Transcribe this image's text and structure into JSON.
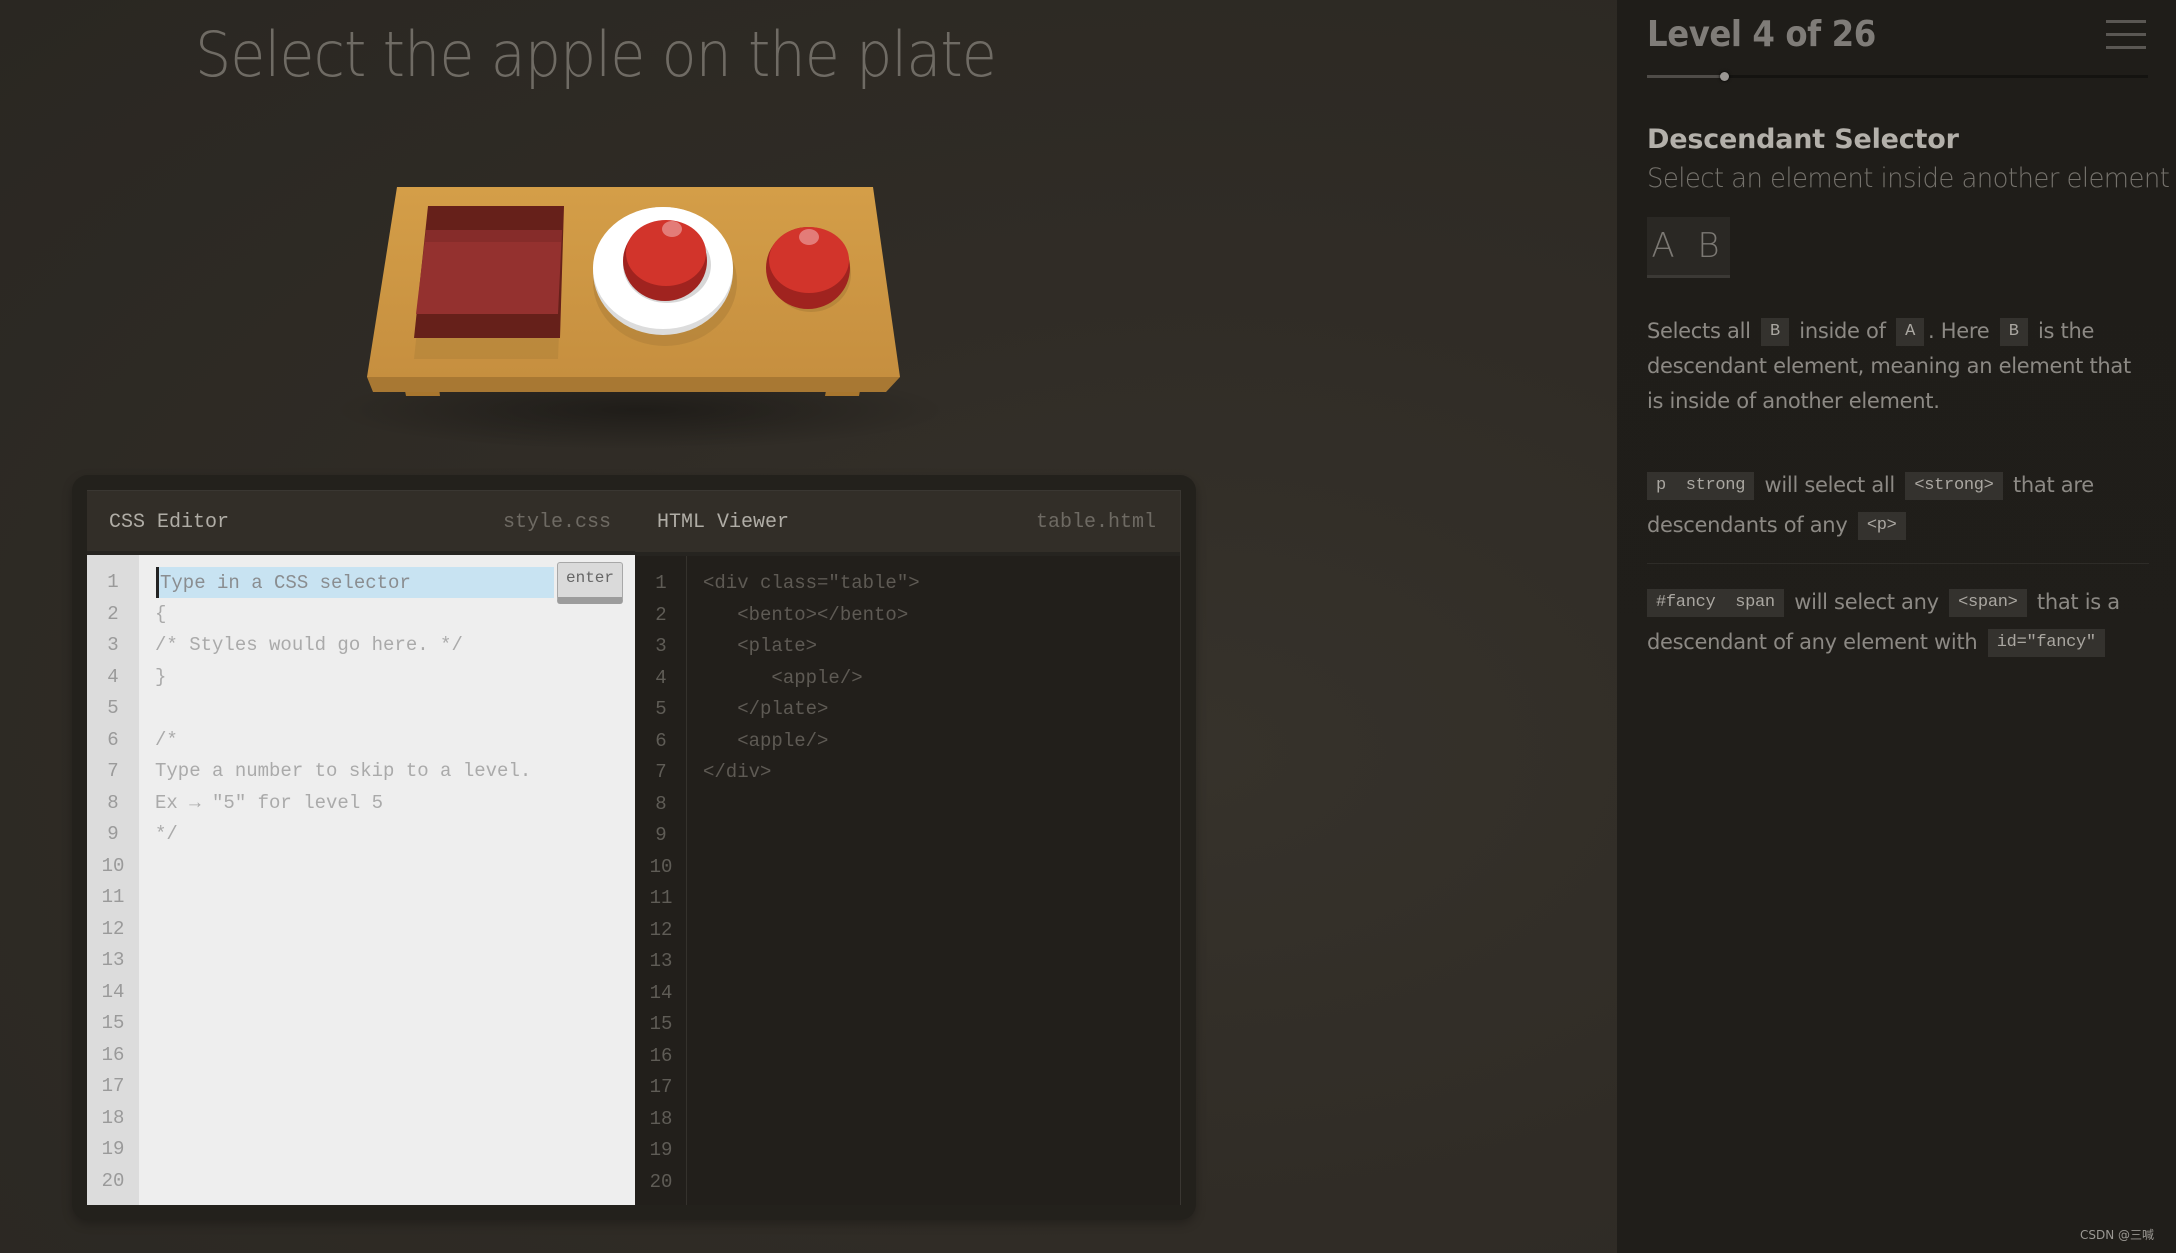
{
  "game": {
    "instruction": "Select the apple on the plate",
    "table_items": [
      "bento",
      "plate with apple",
      "apple"
    ]
  },
  "css_editor": {
    "name": "CSS Editor",
    "file": "style.css",
    "input_placeholder": "Type in a CSS selector",
    "input_value": "",
    "enter_label": "enter",
    "line_numbers": [
      "1",
      "2",
      "3",
      "4",
      "5",
      "6",
      "7",
      "8",
      "9",
      "10",
      "11",
      "12",
      "13",
      "14",
      "15",
      "16",
      "17",
      "18",
      "19",
      "20"
    ],
    "lines": [
      "",
      "{",
      "/* Styles would go here. */",
      "}",
      "",
      "/*",
      "Type a number to skip to a level.",
      "Ex → \"5\" for level 5",
      "*/"
    ]
  },
  "html_viewer": {
    "name": "HTML Viewer",
    "file": "table.html",
    "line_numbers": [
      "1",
      "2",
      "3",
      "4",
      "5",
      "6",
      "7",
      "8",
      "9",
      "10",
      "11",
      "12",
      "13",
      "14",
      "15",
      "16",
      "17",
      "18",
      "19",
      "20"
    ],
    "lines": [
      "<div class=\"table\">",
      "   <bento></bento>",
      "   <plate>",
      "      <apple/>",
      "   </plate>",
      "   <apple/>",
      "</div>"
    ]
  },
  "sidebar": {
    "level_label": "Level 4 of 26",
    "level_current": 4,
    "level_total": 26,
    "progress_fraction": 0.154,
    "menu_icon": "hamburger-icon",
    "selector_name": "Descendant Selector",
    "selector_title": "Select an element inside another element",
    "syntax": "A B",
    "hint": {
      "t1": "Selects all ",
      "c1": "B",
      "t2": " inside of ",
      "c2": "A",
      "t3": ". Here ",
      "c3": "B",
      "t4": " is the descendant element, meaning an element that is inside of another element."
    },
    "examples": [
      {
        "code": "p  strong",
        "t1": " will select all ",
        "tag": "<strong>",
        "t2": " that are descendants of any ",
        "tag2": "<p>"
      },
      {
        "code": "#fancy  span",
        "t1": " will select any ",
        "tag": "<span>",
        "t2": " that is a descendant of any element with ",
        "tag2": "id=\"fancy\""
      }
    ]
  },
  "watermark": "CSDN @三喊",
  "colors": {
    "table": "#cf9a46",
    "apple": "#d2342b",
    "bento": "#94312f",
    "plate": "#ffffff",
    "input_highlight": "#c8e3f2"
  }
}
